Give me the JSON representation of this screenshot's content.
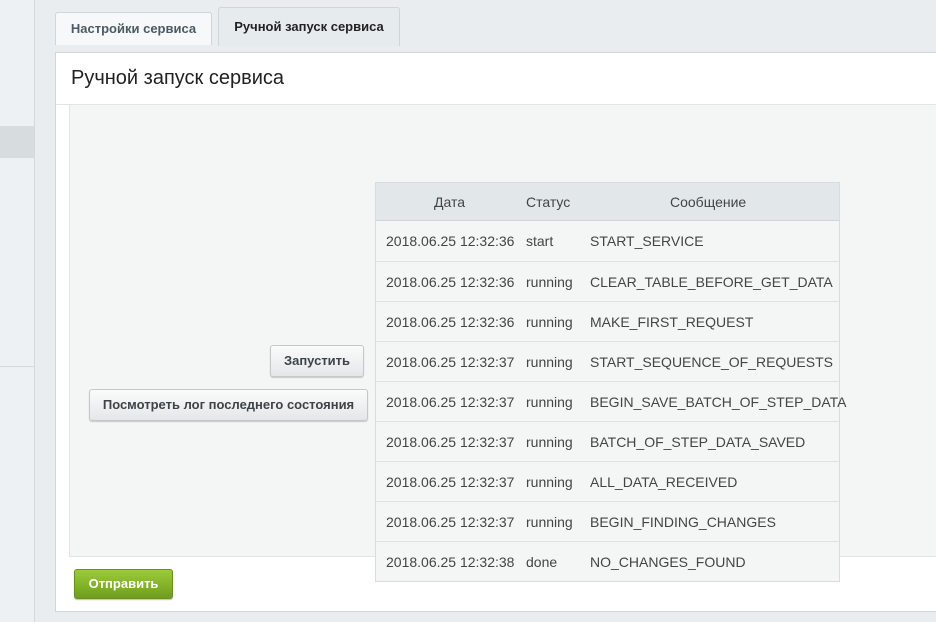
{
  "tabs": [
    {
      "label": "Настройки сервиса",
      "active": false
    },
    {
      "label": "Ручной запуск сервиса",
      "active": true
    }
  ],
  "panel": {
    "title": "Ручной запуск сервиса",
    "run_button": "Запустить",
    "log_button": "Посмотреть лог последнего состояния",
    "submit_button": "Отправить"
  },
  "log": {
    "headers": {
      "date": "Дата",
      "status": "Статус",
      "message": "Сообщение"
    },
    "rows": [
      {
        "date": "2018.06.25 12:32:36",
        "status": "start",
        "message": "START_SERVICE"
      },
      {
        "date": "2018.06.25 12:32:36",
        "status": "running",
        "message": "CLEAR_TABLE_BEFORE_GET_DATA"
      },
      {
        "date": "2018.06.25 12:32:36",
        "status": "running",
        "message": "MAKE_FIRST_REQUEST"
      },
      {
        "date": "2018.06.25 12:32:37",
        "status": "running",
        "message": "START_SEQUENCE_OF_REQUESTS"
      },
      {
        "date": "2018.06.25 12:32:37",
        "status": "running",
        "message": "BEGIN_SAVE_BATCH_OF_STEP_DATA"
      },
      {
        "date": "2018.06.25 12:32:37",
        "status": "running",
        "message": "BATCH_OF_STEP_DATA_SAVED"
      },
      {
        "date": "2018.06.25 12:32:37",
        "status": "running",
        "message": "ALL_DATA_RECEIVED"
      },
      {
        "date": "2018.06.25 12:32:37",
        "status": "running",
        "message": "BEGIN_FINDING_CHANGES"
      },
      {
        "date": "2018.06.25 12:32:38",
        "status": "done",
        "message": "NO_CHANGES_FOUND"
      }
    ]
  },
  "colors": {
    "submit_button": "#7fae29",
    "table_header": "#e2e7e9",
    "active_tab": "#e6ebed"
  }
}
